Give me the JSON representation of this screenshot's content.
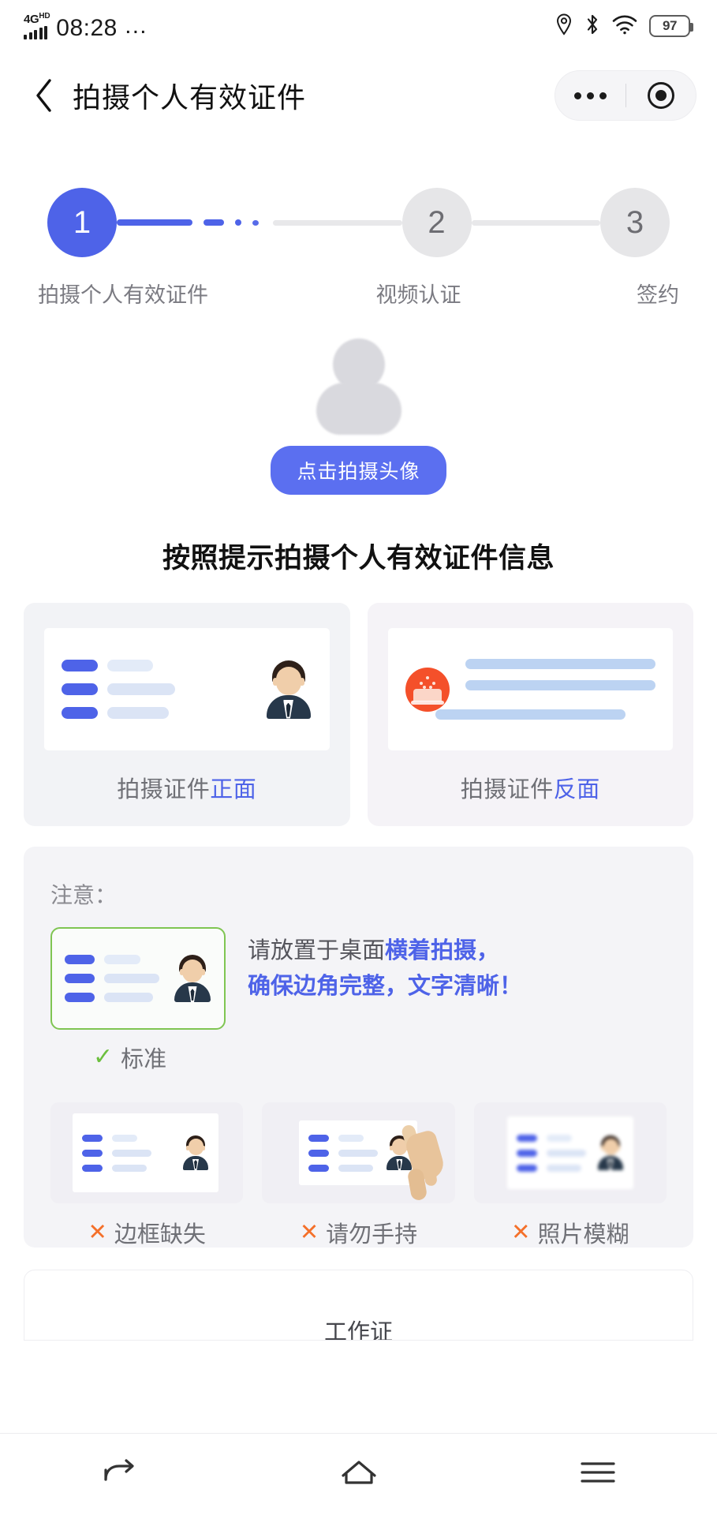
{
  "status_bar": {
    "network_type": "4G",
    "network_suffix": "HD",
    "time": "08:28",
    "time_dots": "…",
    "battery_percent": "97",
    "icons": [
      "location-icon",
      "bluetooth-icon",
      "wifi-icon",
      "battery-icon"
    ]
  },
  "header": {
    "back_icon": "chevron-left-icon",
    "title": "拍摄个人有效证件",
    "capsule": {
      "more_icon": "more-dots-icon",
      "target_icon": "target-circle-icon"
    }
  },
  "stepper": {
    "steps": [
      {
        "number": "1",
        "label": "拍摄个人有效证件",
        "state": "active"
      },
      {
        "number": "2",
        "label": "视频认证",
        "state": "idle"
      },
      {
        "number": "3",
        "label": "签约",
        "state": "idle"
      }
    ],
    "active_color": "#4e63e8",
    "idle_color": "#e6e6e8"
  },
  "avatar_section": {
    "avatar_icon": "person-placeholder-icon",
    "button_label": "点击拍摄头像",
    "button_color": "#5b6ff0"
  },
  "heading": "按照提示拍摄个人有效证件信息",
  "id_cards": [
    {
      "name": "front",
      "caption_prefix": "拍摄证件",
      "caption_highlight": "正面",
      "thumb_icon": "id-card-front-icon"
    },
    {
      "name": "back",
      "caption_prefix": "拍摄证件",
      "caption_highlight": "反面",
      "thumb_icon": "id-card-back-emblem-icon"
    }
  ],
  "notice": {
    "title": "注意：",
    "standard": {
      "caption": "标准",
      "check_icon": "check-icon",
      "check_color": "#6cbf3e",
      "border_color": "#7fc552"
    },
    "instruction": {
      "line1_plain": "请放置于桌面",
      "line1_highlight": "横着拍摄，",
      "line2": "确保边角完整，文字清晰！",
      "highlight_color": "#4e63e8"
    },
    "bad_examples": [
      {
        "label": "边框缺失",
        "icon": "cropped-card-icon",
        "mark": "✕"
      },
      {
        "label": "请勿手持",
        "icon": "hand-holding-card-icon",
        "mark": "✕"
      },
      {
        "label": "照片模糊",
        "icon": "blurry-card-icon",
        "mark": "✕"
      }
    ],
    "mark_color": "#f4702a"
  },
  "bottom_card": {
    "text": "工作证"
  },
  "nav_bar": {
    "items": [
      {
        "icon": "back-arrow-icon"
      },
      {
        "icon": "home-icon"
      },
      {
        "icon": "recents-menu-icon"
      }
    ]
  }
}
